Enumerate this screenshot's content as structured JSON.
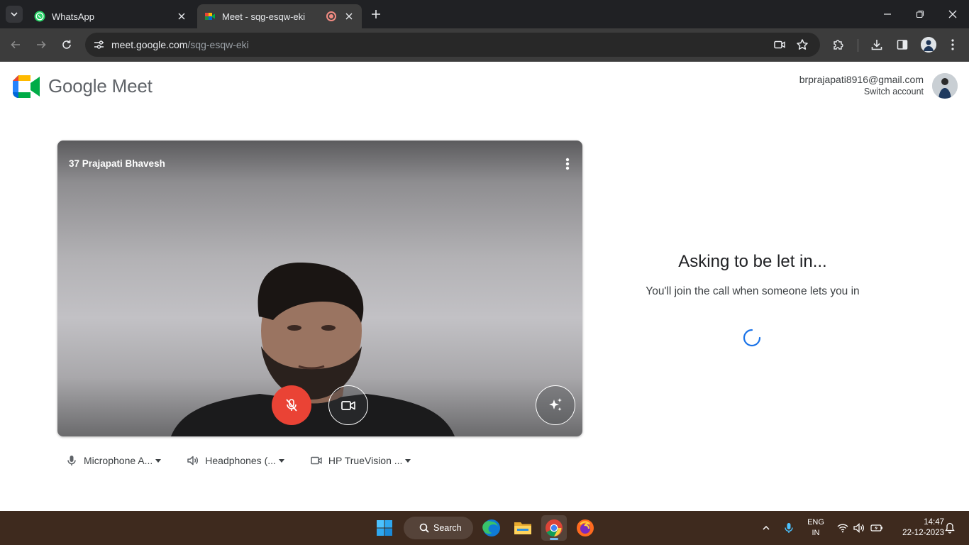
{
  "browser": {
    "tabs": [
      {
        "title": "WhatsApp",
        "active": false,
        "icon": "whatsapp-icon"
      },
      {
        "title": "Meet - sqg-esqw-eki",
        "active": true,
        "icon": "google-meet-icon",
        "recording": true
      }
    ],
    "address_bar": {
      "host": "meet.google.com",
      "path": "/sqg-esqw-eki"
    }
  },
  "page": {
    "brand": "Google Meet",
    "account": {
      "email": "brprajapati8916@gmail.com",
      "switch_label": "Switch account"
    },
    "preview": {
      "participant_name": "37 Prajapati Bhavesh",
      "mic_on": false,
      "camera_on": true
    },
    "devices": [
      {
        "icon": "microphone-icon",
        "label": "Microphone A..."
      },
      {
        "icon": "speaker-icon",
        "label": "Headphones (..."
      },
      {
        "icon": "camera-icon",
        "label": "HP TrueVision ..."
      }
    ],
    "status": {
      "heading": "Asking to be let in...",
      "message": "You'll join the call when someone lets you in"
    }
  },
  "taskbar": {
    "search_label": "Search",
    "language": {
      "line1": "ENG",
      "line2": "IN"
    },
    "time": "14:47",
    "date": "22-12-2023"
  },
  "colors": {
    "mic_off": "#ea4335",
    "accent": "#1a73e8",
    "chrome_dark": "#202124",
    "taskbar": "#3e2a1e"
  }
}
